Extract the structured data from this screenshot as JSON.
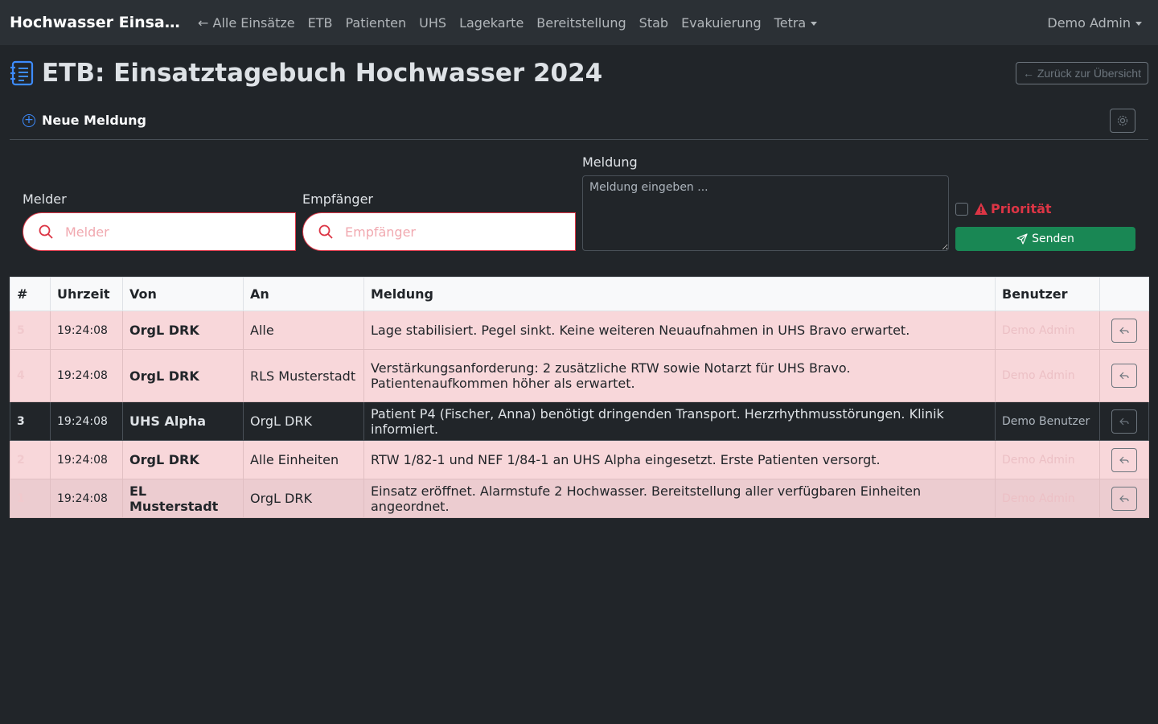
{
  "navbar": {
    "brand": "Hochwasser Einsat...",
    "links": [
      "← Alle Einsätze",
      "ETB",
      "Patienten",
      "UHS",
      "Lagekarte",
      "Bereitstellung",
      "Stab",
      "Evakuierung"
    ],
    "tetra": "Tetra",
    "user": "Demo Admin"
  },
  "header": {
    "title": "ETB: Einsatztagebuch Hochwasser 2024",
    "back_button": "← Zurück zur Übersicht",
    "icon": "journal-text-icon"
  },
  "form": {
    "card_title": "Neue Meldung",
    "melder_label": "Melder",
    "melder_placeholder": "Melder",
    "empfaenger_label": "Empfänger",
    "empfaenger_placeholder": "Empfänger",
    "meldung_label": "Meldung",
    "meldung_placeholder": "Meldung eingeben ...",
    "prioritaet_label": "Priorität",
    "send_label": "Senden"
  },
  "table": {
    "headers": [
      "#",
      "Uhrzeit",
      "Von",
      "An",
      "Meldung",
      "Benutzer",
      ""
    ],
    "rows": [
      {
        "num": "5",
        "time": "19:24:08",
        "von": "OrgL DRK",
        "an": "Alle",
        "meldung": "Lage stabilisiert. Pegel sinkt. Keine weiteren Neuaufnahmen in UHS Bravo erwartet.",
        "user": "Demo Admin",
        "priority": true
      },
      {
        "num": "4",
        "time": "19:24:08",
        "von": "OrgL DRK",
        "an": "RLS Musterstadt",
        "meldung": "Verstärkungsanforderung: 2 zusätzliche RTW sowie Notarzt für UHS Bravo. Patientenaufkommen höher als erwartet.",
        "user": "Demo Admin",
        "priority": true
      },
      {
        "num": "3",
        "time": "19:24:08",
        "von": "UHS Alpha",
        "an": "OrgL DRK",
        "meldung": "Patient P4 (Fischer, Anna) benötigt dringenden Transport. Herzrhythmusstörungen. Klinik informiert.",
        "user": "Demo Benutzer",
        "priority": false
      },
      {
        "num": "2",
        "time": "19:24:08",
        "von": "OrgL DRK",
        "an": "Alle Einheiten",
        "meldung": "RTW 1/82-1 und NEF 1/84-1 an UHS Alpha eingesetzt. Erste Patienten versorgt.",
        "user": "Demo Admin",
        "priority": true
      },
      {
        "num": "1",
        "time": "19:24:08",
        "von": "EL Musterstadt",
        "an": "OrgL DRK",
        "meldung": "Einsatz eröffnet. Alarmstufe 2 Hochwasser. Bereitstellung aller verfügbaren Einheiten angeordnet.",
        "user": "Demo Admin",
        "priority": true
      }
    ]
  },
  "colors": {
    "accent_blue": "#3d8bfd",
    "danger": "#dc3545",
    "success": "#198754",
    "priority_row": "#f8d7da"
  }
}
